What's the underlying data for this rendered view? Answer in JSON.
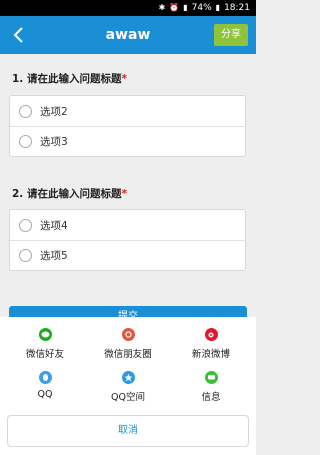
{
  "status": {
    "battery": "74%",
    "time": "18:21"
  },
  "header": {
    "title": "awaw",
    "share_label": "分享"
  },
  "questions": [
    {
      "title": "1. 请在此输入问题标题",
      "required_mark": "*",
      "options": [
        "选项2",
        "选项3"
      ]
    },
    {
      "title": "2. 请在此输入问题标题",
      "required_mark": "*",
      "options": [
        "选项4",
        "选项5"
      ]
    }
  ],
  "submit_label": "提交",
  "share_sheet": {
    "items": [
      {
        "label": "微信好友",
        "icon": "wechat-icon",
        "color": "#1aad19"
      },
      {
        "label": "微信朋友圈",
        "icon": "moments-icon",
        "color": "#e8553e"
      },
      {
        "label": "新浪微博",
        "icon": "weibo-icon",
        "color": "#e6162d"
      },
      {
        "label": "QQ",
        "icon": "qq-icon",
        "color": "#3ba0e6"
      },
      {
        "label": "QQ空间",
        "icon": "qzone-icon",
        "color": "#2c9be0"
      },
      {
        "label": "信息",
        "icon": "message-icon",
        "color": "#3bbf3b"
      }
    ],
    "cancel_label": "取消"
  },
  "colors": {
    "accent": "#1a8fd6",
    "share_button": "#8ec33b",
    "required": "#e01e1e"
  }
}
